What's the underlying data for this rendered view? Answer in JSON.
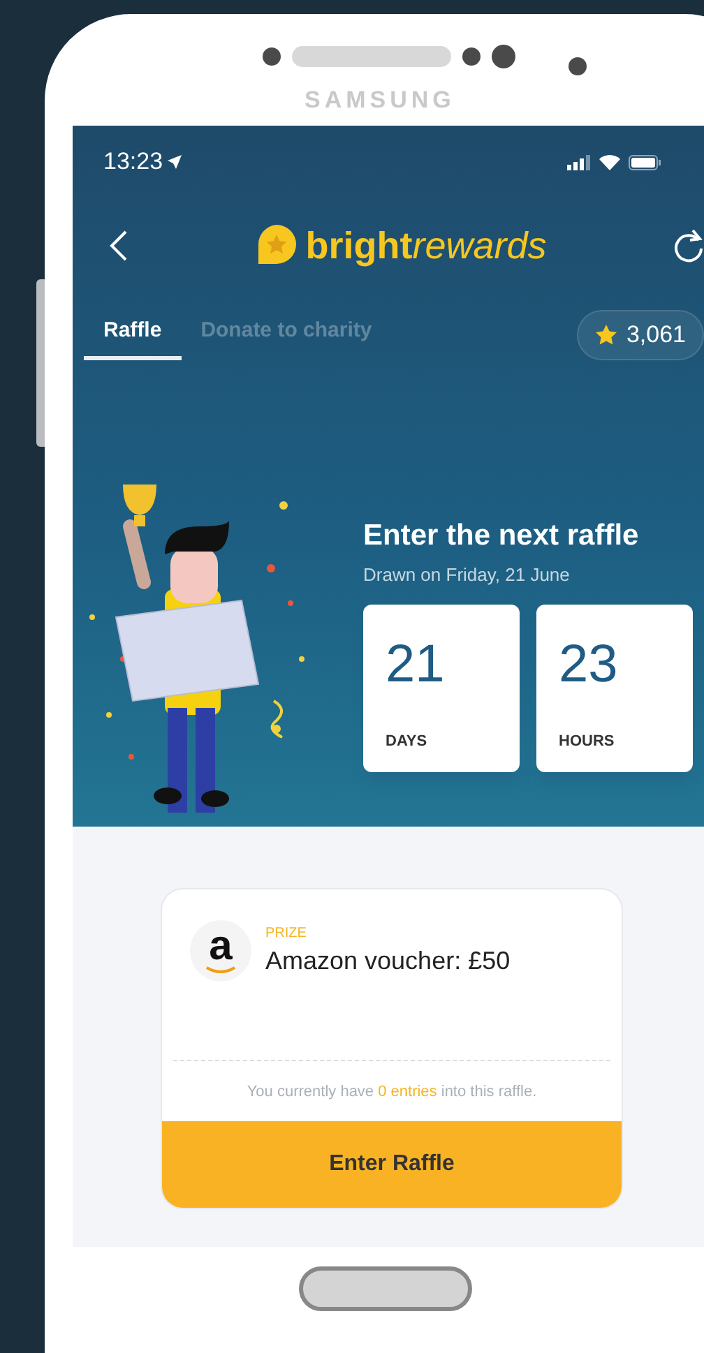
{
  "device": {
    "brand": "SAMSUNG"
  },
  "status_bar": {
    "time": "13:23"
  },
  "header": {
    "logo_bold": "bright",
    "logo_italic": "rewards"
  },
  "tabs": [
    {
      "label": "Raffle",
      "selected": true
    },
    {
      "label": "Donate to charity",
      "selected": false
    }
  ],
  "points": {
    "value": "3,061"
  },
  "raffle": {
    "title": "Enter the next raffle",
    "subtitle": "Drawn on Friday, 21 June",
    "countdown": [
      {
        "value": "21",
        "unit": "DAYS"
      },
      {
        "value": "23",
        "unit": "HOURS"
      }
    ]
  },
  "prize": {
    "logo_letter": "a",
    "label": "PRIZE",
    "name": "Amazon voucher: £50",
    "entries_note": "You currently have **0 entries** into this raffle.",
    "button": "Enter Raffle"
  }
}
